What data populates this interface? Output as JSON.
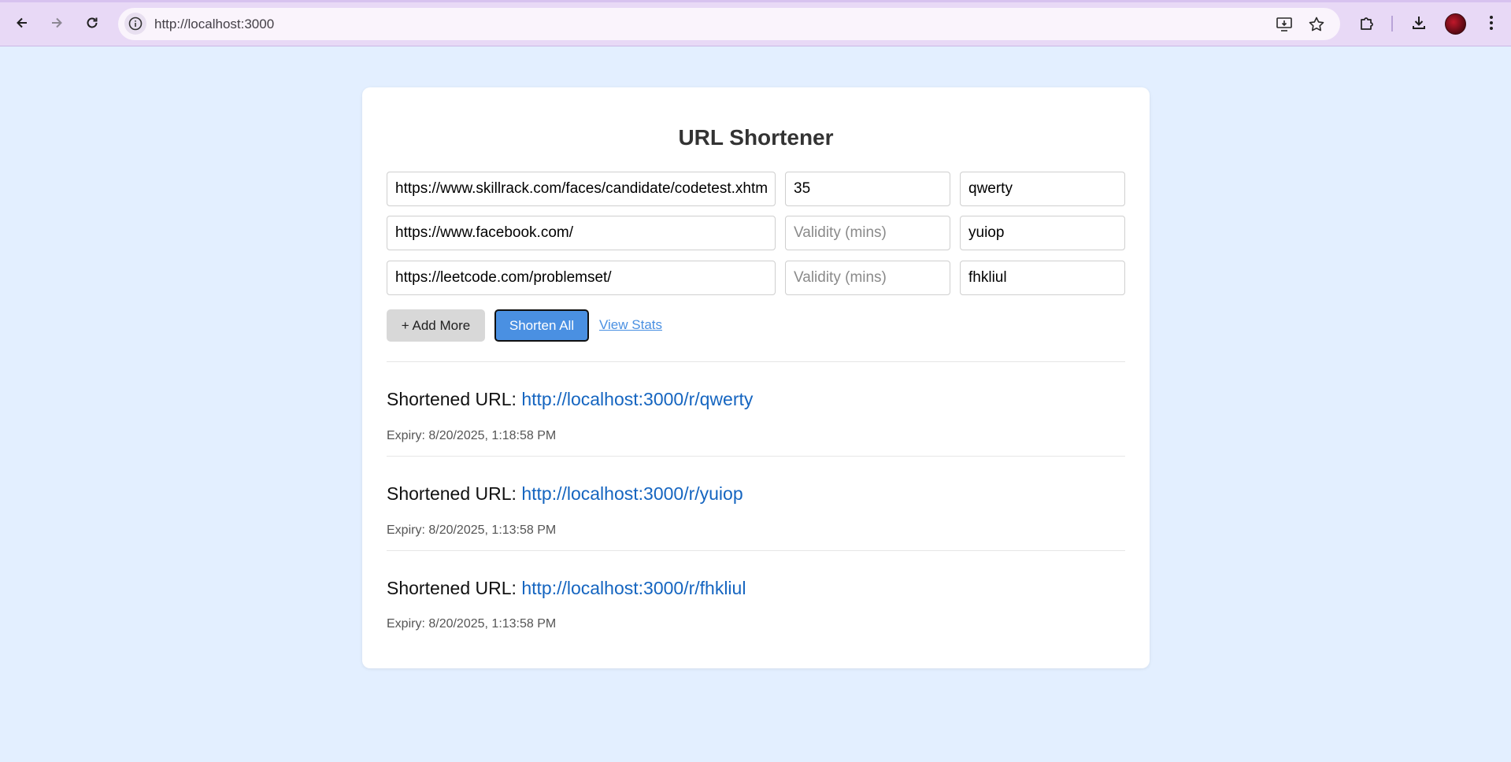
{
  "browser": {
    "url": "http://localhost:3000"
  },
  "app": {
    "title": "URL Shortener",
    "rows": [
      {
        "url": "https://www.skillrack.com/faces/candidate/codetest.xhtml",
        "validity": "35",
        "shortcode": "qwerty"
      },
      {
        "url": "https://www.facebook.com/",
        "validity": "",
        "shortcode": "yuiop"
      },
      {
        "url": "https://leetcode.com/problemset/",
        "validity": "",
        "shortcode": "fhkliul"
      }
    ],
    "validity_placeholder": "Validity (mins)",
    "add_more_label": "+ Add More",
    "shorten_all_label": "Shorten All",
    "view_stats_label": "View Stats",
    "results": [
      {
        "label": "Shortened URL:",
        "link": "http://localhost:3000/r/qwerty",
        "expiry": "Expiry: 8/20/2025, 1:18:58 PM"
      },
      {
        "label": "Shortened URL:",
        "link": "http://localhost:3000/r/yuiop",
        "expiry": "Expiry: 8/20/2025, 1:13:58 PM"
      },
      {
        "label": "Shortened URL:",
        "link": "http://localhost:3000/r/fhkliul",
        "expiry": "Expiry: 8/20/2025, 1:13:58 PM"
      }
    ]
  },
  "colors": {
    "page_bg": "#e3efff",
    "accent": "#4a90e2",
    "link": "#1565c0"
  }
}
